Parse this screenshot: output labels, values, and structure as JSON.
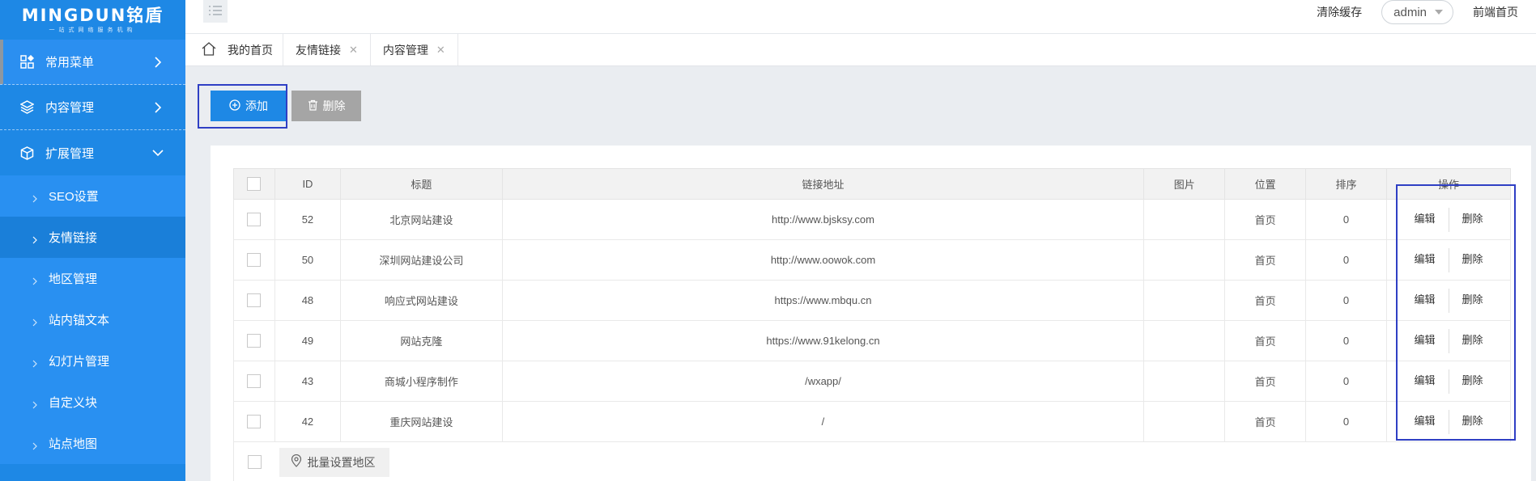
{
  "app": {
    "logo_text": "MINGDUN铭盾",
    "logo_sub": "一站式网络服务机构"
  },
  "sidebar": {
    "menus": [
      {
        "label": "常用菜单",
        "icon": "grid-icon",
        "expanded": false
      },
      {
        "label": "内容管理",
        "icon": "layers-icon",
        "expanded": false
      },
      {
        "label": "扩展管理",
        "icon": "cube-icon",
        "expanded": true
      }
    ],
    "sub_items": [
      {
        "label": "SEO设置",
        "active": false
      },
      {
        "label": "友情链接",
        "active": true
      },
      {
        "label": "地区管理",
        "active": false
      },
      {
        "label": "站内锚文本",
        "active": false
      },
      {
        "label": "幻灯片管理",
        "active": false
      },
      {
        "label": "自定义块",
        "active": false
      },
      {
        "label": "站点地图",
        "active": false
      }
    ]
  },
  "topbar": {
    "clear_cache": "清除缓存",
    "user": "admin",
    "frontend_home": "前端首页"
  },
  "tabs": [
    {
      "label": "我的首页",
      "closable": false
    },
    {
      "label": "友情链接",
      "closable": true
    },
    {
      "label": "内容管理",
      "closable": true
    }
  ],
  "toolbar": {
    "add_label": "添加",
    "delete_label": "删除"
  },
  "table": {
    "headers": [
      "ID",
      "标题",
      "链接地址",
      "图片",
      "位置",
      "排序",
      "操作"
    ],
    "rows": [
      {
        "id": "52",
        "title": "北京网站建设",
        "url": "http://www.bjsksy.com",
        "image": "",
        "position": "首页",
        "sort": "0"
      },
      {
        "id": "50",
        "title": "深圳网站建设公司",
        "url": "http://www.oowok.com",
        "image": "",
        "position": "首页",
        "sort": "0"
      },
      {
        "id": "48",
        "title": "响应式网站建设",
        "url": "https://www.mbqu.cn",
        "image": "",
        "position": "首页",
        "sort": "0"
      },
      {
        "id": "49",
        "title": "网站克隆",
        "url": "https://www.91kelong.cn",
        "image": "",
        "position": "首页",
        "sort": "0"
      },
      {
        "id": "43",
        "title": "商城小程序制作",
        "url": "/wxapp/",
        "image": "",
        "position": "首页",
        "sort": "0"
      },
      {
        "id": "42",
        "title": "重庆网站建设",
        "url": "/",
        "image": "",
        "position": "首页",
        "sort": "0"
      }
    ],
    "row_actions": {
      "edit": "编辑",
      "delete": "删除"
    },
    "batch_button": "批量设置地区"
  },
  "colors": {
    "primary": "#1e88e5",
    "sidebar_active": "#1a7fd9",
    "highlight_box": "#2f3fc4",
    "delete_button": "#a5a5a5"
  }
}
